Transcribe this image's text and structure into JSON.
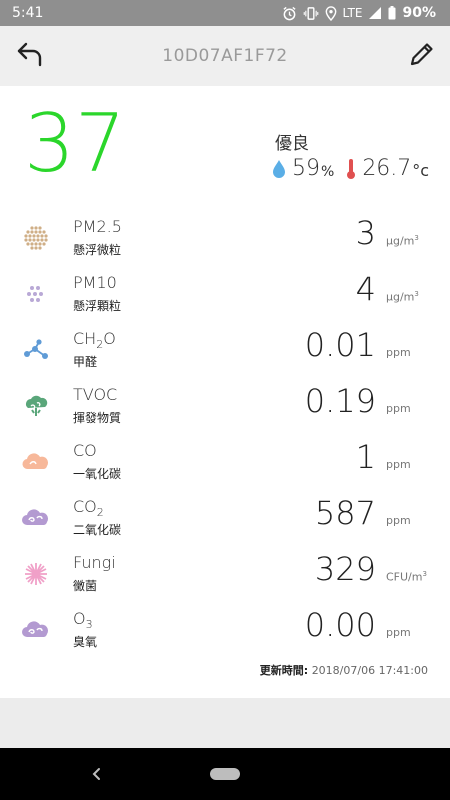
{
  "status_bar": {
    "time": "5:41",
    "network": "LTE",
    "battery": "90%"
  },
  "app_bar": {
    "title": "10D07AF1F72",
    "back_icon": "back-arrow-icon",
    "edit_icon": "pencil-icon"
  },
  "summary": {
    "aqi": "37",
    "level": "優良",
    "humidity": "59",
    "humidity_unit": "%",
    "temperature": "26.7",
    "temperature_unit": "°c",
    "colors": {
      "aqi": "#2bd62b",
      "humidity_icon": "#5aaee6",
      "temp_icon": "#e05050"
    }
  },
  "metrics": [
    {
      "name": "PM2.5",
      "name_sub": "",
      "label": "懸浮微粒",
      "value": "3",
      "unit": "μg/m",
      "unit_sup": "3",
      "icon": "pm25-dots-icon"
    },
    {
      "name": "PM10",
      "name_sub": "",
      "label": "懸浮顆粒",
      "value": "4",
      "unit": "μg/m",
      "unit_sup": "3",
      "icon": "pm10-dots-icon"
    },
    {
      "name": "CH",
      "name_sub": "2",
      "name_tail": "O",
      "label": "甲醛",
      "value": "0.01",
      "unit": "ppm",
      "unit_sup": "",
      "icon": "molecule-icon"
    },
    {
      "name": "TVOC",
      "name_sub": "",
      "label": "揮發物質",
      "value": "0.19",
      "unit": "ppm",
      "unit_sup": "",
      "icon": "tvoc-cloud-icon"
    },
    {
      "name": "CO",
      "name_sub": "",
      "label": "一氧化碳",
      "value": "1",
      "unit": "ppm",
      "unit_sup": "",
      "icon": "co-cloud-icon"
    },
    {
      "name": "CO",
      "name_sub": "2",
      "label": "二氧化碳",
      "value": "587",
      "unit": "ppm",
      "unit_sup": "",
      "icon": "co2-cloud-icon"
    },
    {
      "name": "Fungi",
      "name_sub": "",
      "label": "黴菌",
      "value": "329",
      "unit": "CFU/m",
      "unit_sup": "3",
      "icon": "fungi-burst-icon"
    },
    {
      "name": "O",
      "name_sub": "3",
      "label": "臭氧",
      "value": "0.00",
      "unit": "ppm",
      "unit_sup": "",
      "icon": "o3-cloud-icon"
    }
  ],
  "updated": {
    "label": "更新時間:",
    "value": "2018/07/06 17:41:00"
  }
}
